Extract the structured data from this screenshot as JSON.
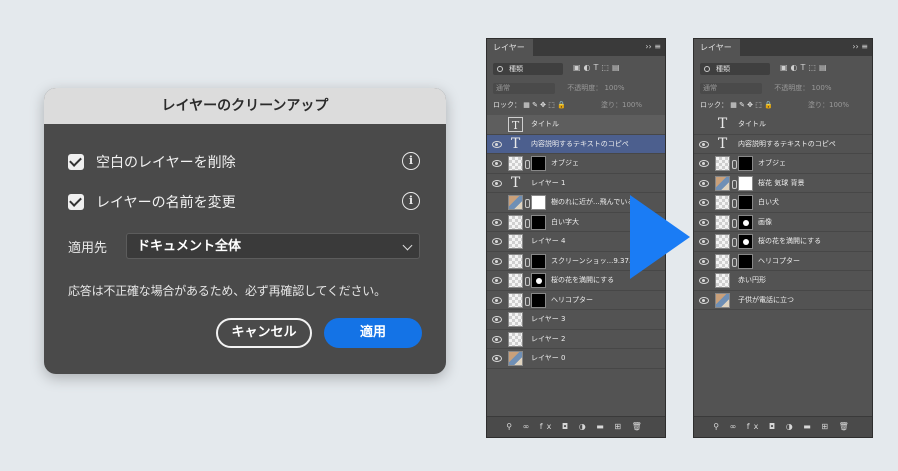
{
  "dialog": {
    "title": "レイヤーのクリーンアップ",
    "options": [
      {
        "label": "空白のレイヤーを削除",
        "checked": true,
        "info_icon": "info-icon"
      },
      {
        "label": "レイヤーの名前を変更",
        "checked": true,
        "info_icon": "info-icon"
      }
    ],
    "apply_to_label": "適用先",
    "apply_to_value": "ドキュメント全体",
    "note": "応答は不正確な場合があるため、必ず再確認してください。",
    "cancel_label": "キャンセル",
    "apply_label": "適用",
    "accent": "#1473e6"
  },
  "panel_before": {
    "tab": "レイヤー",
    "filter_kind": "種類",
    "blend": "通常",
    "opacity_label": "不透明度：",
    "opacity": "100%",
    "lock_label": "ロック：",
    "fill_label": "塗り：",
    "fill": "100%",
    "layers": [
      {
        "name": "タイトル",
        "eye": false,
        "thumb": "text-boxed",
        "mask": "none",
        "state": "hl"
      },
      {
        "name": "内容説明するテキストのコピペ",
        "eye": true,
        "thumb": "text",
        "mask": "none",
        "state": "sel"
      },
      {
        "name": "オブジェ",
        "eye": true,
        "thumb": "trans",
        "mask": "black"
      },
      {
        "name": "レイヤー 1",
        "eye": true,
        "thumb": "text",
        "mask": "none"
      },
      {
        "name": "樹のれに近が...飛んでいる",
        "eye": false,
        "thumb": "photo",
        "mask": "white"
      },
      {
        "name": "白い字大",
        "eye": true,
        "thumb": "trans",
        "mask": "black"
      },
      {
        "name": "レイヤー 4",
        "eye": true,
        "thumb": "trans",
        "mask": "none"
      },
      {
        "name": "スクリーンショッ...9.37.4",
        "eye": true,
        "thumb": "trans",
        "mask": "black"
      },
      {
        "name": "桜の花を満開にする",
        "eye": true,
        "thumb": "trans",
        "mask": "dot"
      },
      {
        "name": "ヘリコプター",
        "eye": true,
        "thumb": "trans",
        "mask": "black"
      },
      {
        "name": "レイヤー 3",
        "eye": true,
        "thumb": "trans",
        "mask": "none"
      },
      {
        "name": "レイヤー 2",
        "eye": true,
        "thumb": "trans",
        "mask": "none"
      },
      {
        "name": "レイヤー 0",
        "eye": true,
        "thumb": "photo",
        "mask": "none"
      }
    ]
  },
  "panel_after": {
    "tab": "レイヤー",
    "filter_kind": "種類",
    "blend": "通常",
    "opacity_label": "不透明度：",
    "opacity": "100%",
    "lock_label": "ロック：",
    "fill_label": "塗り：",
    "fill": "100%",
    "layers": [
      {
        "name": "タイトル",
        "eye": false,
        "thumb": "text",
        "mask": "none"
      },
      {
        "name": "内容説明するテキストのコピペ",
        "eye": true,
        "thumb": "text",
        "mask": "none"
      },
      {
        "name": "オブジェ",
        "eye": true,
        "thumb": "trans",
        "mask": "black"
      },
      {
        "name": "桜花 気球 背景",
        "eye": true,
        "thumb": "photo",
        "mask": "white"
      },
      {
        "name": "白い犬",
        "eye": true,
        "thumb": "trans",
        "mask": "black"
      },
      {
        "name": "画像",
        "eye": true,
        "thumb": "trans",
        "mask": "dot"
      },
      {
        "name": "桜の花を満開にする",
        "eye": true,
        "thumb": "trans",
        "mask": "dot"
      },
      {
        "name": "ヘリコプター",
        "eye": true,
        "thumb": "trans",
        "mask": "black"
      },
      {
        "name": "赤い円形",
        "eye": true,
        "thumb": "trans",
        "mask": "none"
      },
      {
        "name": "子供が電話に立つ",
        "eye": true,
        "thumb": "photo",
        "mask": "none"
      }
    ]
  },
  "arrow_color": "#1a7cf5"
}
